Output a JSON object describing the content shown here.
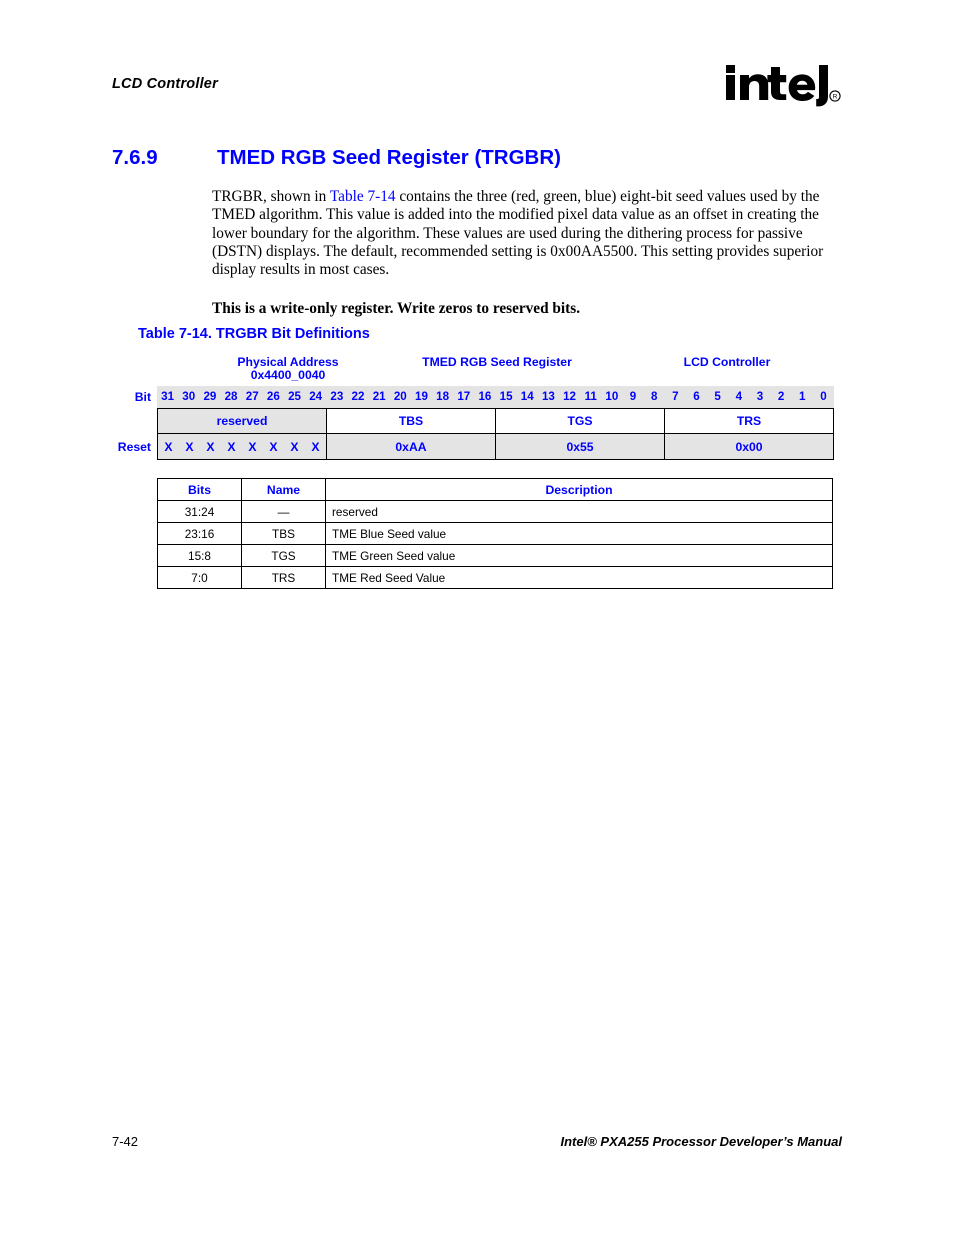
{
  "running_head": "LCD Controller",
  "logo": {
    "wordmark": "intel",
    "registered_mark": "®"
  },
  "section": {
    "number": "7.6.9",
    "title": "TMED RGB Seed Register (TRGBR)"
  },
  "body": {
    "paragraph_part1": "TRGBR, shown in ",
    "paragraph_xref": "Table 7-14",
    "paragraph_part2": " contains the three (red, green, blue) eight-bit seed values used by the TMED algorithm. This value is added into the modified pixel data value as an offset in creating the lower boundary for the algorithm. These values are used during the dithering process for passive (DSTN) displays. The default, recommended setting is 0x00AA5500. This setting provides superior display results in most cases.",
    "note": "This is a write-only register. Write zeros to reserved bits."
  },
  "table_caption": "Table 7-14. TRGBR Bit Definitions",
  "register": {
    "header_labels": {
      "physical_address": "Physical Address\n0x4400_0040",
      "register_name": "TMED RGB Seed Register",
      "block_name": "LCD Controller"
    },
    "bit_label": "Bit",
    "reset_label": "Reset",
    "bits": [
      "31",
      "30",
      "29",
      "28",
      "27",
      "26",
      "25",
      "24",
      "23",
      "22",
      "21",
      "20",
      "19",
      "18",
      "17",
      "16",
      "15",
      "14",
      "13",
      "12",
      "11",
      "10",
      "9",
      "8",
      "7",
      "6",
      "5",
      "4",
      "3",
      "2",
      "1",
      "0"
    ],
    "fields": [
      {
        "name": "reserved",
        "reset": "X X X X X X X X",
        "shaded": true
      },
      {
        "name": "TBS",
        "reset": "0xAA",
        "shaded": false
      },
      {
        "name": "TGS",
        "reset": "0x55",
        "shaded": false
      },
      {
        "name": "TRS",
        "reset": "0x00",
        "shaded": false
      }
    ],
    "reset_x_marks": [
      "X",
      "X",
      "X",
      "X",
      "X",
      "X",
      "X",
      "X"
    ]
  },
  "description_table": {
    "headers": {
      "bits": "Bits",
      "name": "Name",
      "description": "Description"
    },
    "rows": [
      {
        "bits": "31:24",
        "name": "—",
        "description": "reserved"
      },
      {
        "bits": "23:16",
        "name": "TBS",
        "description": "TME Blue Seed value"
      },
      {
        "bits": "15:8",
        "name": "TGS",
        "description": "TME Green Seed value"
      },
      {
        "bits": "7:0",
        "name": "TRS",
        "description": "TME Red Seed Value"
      }
    ]
  },
  "footer": {
    "page_number": "7-42",
    "manual_title": "Intel® PXA255 Processor Developer’s Manual"
  },
  "colors": {
    "accent_blue": "#0000ff",
    "shaded_cell": "#e4e4e4",
    "text_black": "#000000"
  }
}
